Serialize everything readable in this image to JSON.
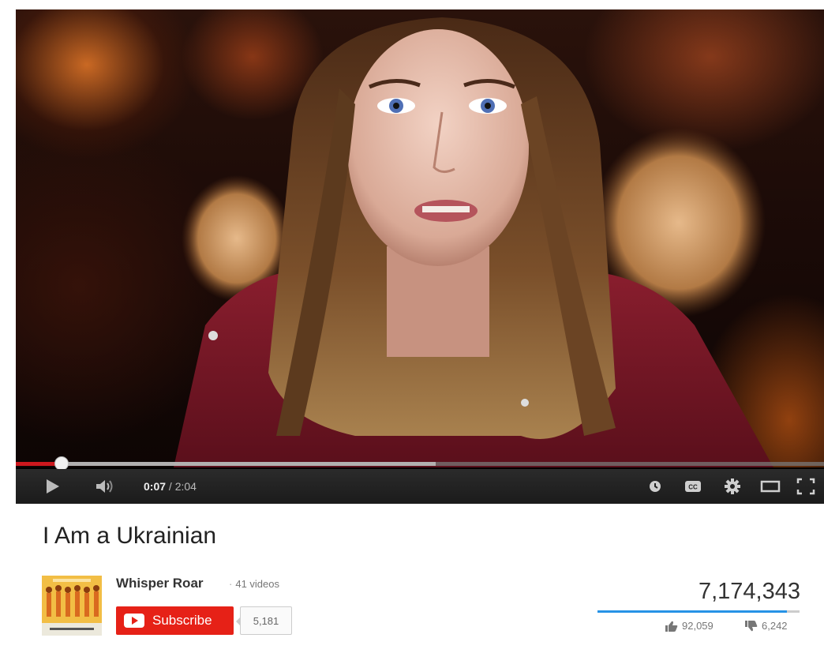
{
  "player": {
    "progress_fraction": 0.057,
    "buffered_fraction": 0.52,
    "time_current": "0:07",
    "time_separator": " / ",
    "time_duration": "2:04",
    "accent_color": "#cc181e",
    "icons": {
      "play": "play-icon",
      "volume": "volume-icon",
      "watch_later": "clock-icon",
      "captions": "cc-icon",
      "settings": "gear-icon",
      "theater": "theater-mode-icon",
      "fullscreen": "fullscreen-icon"
    }
  },
  "video": {
    "title": "I Am a Ukrainian"
  },
  "channel": {
    "name": "Whisper Roar",
    "separator": "·",
    "video_count": "41 videos",
    "subscribe_label": "Subscribe",
    "subscriber_count": "5,181",
    "subscribe_color": "#e62117"
  },
  "stats": {
    "views": "7,174,343",
    "likes": "92,059",
    "dislikes": "6,242",
    "like_ratio": 0.936,
    "like_bar_color": "#2793e6"
  }
}
